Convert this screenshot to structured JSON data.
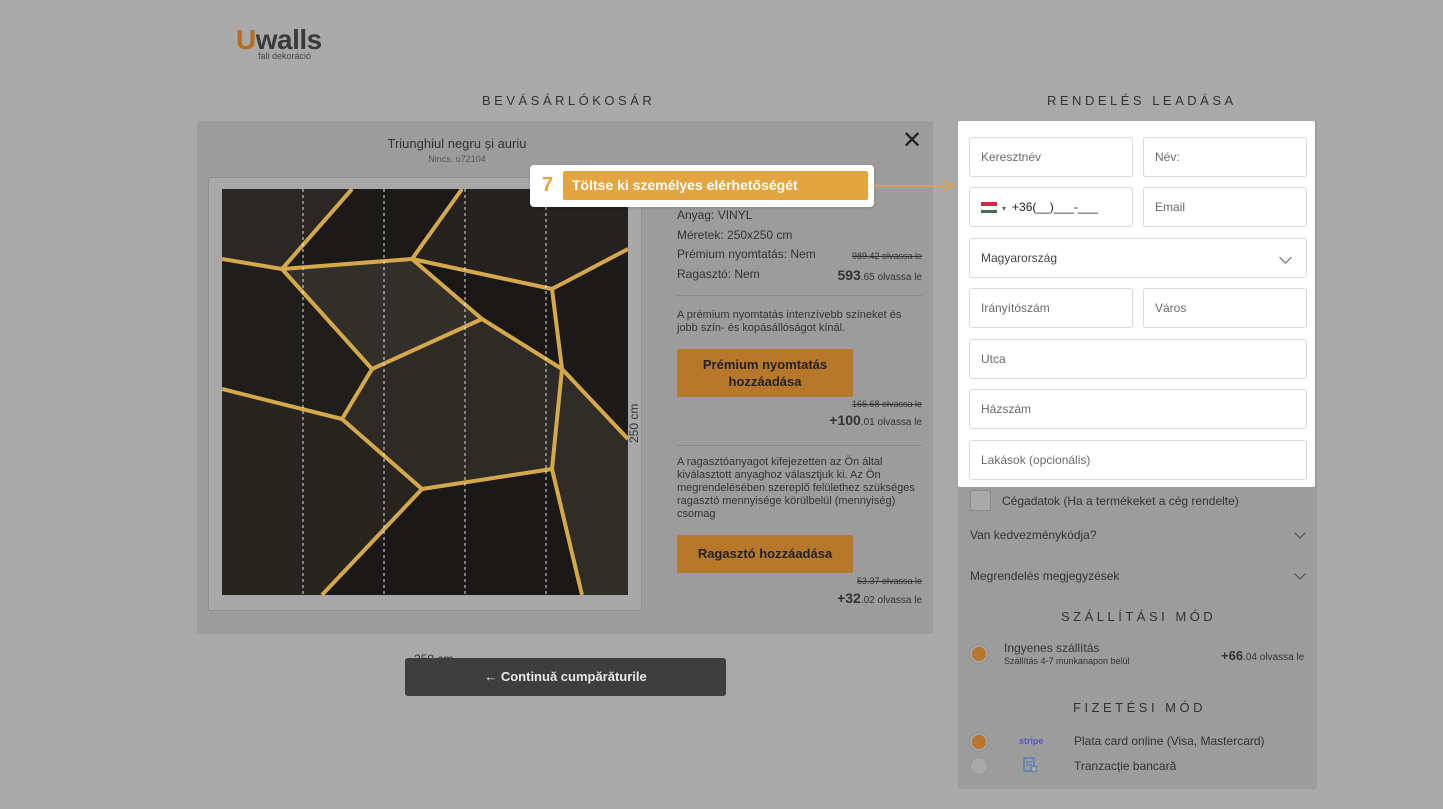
{
  "logo": {
    "brand_prefix": "U",
    "brand_rest": "walls",
    "tagline": "fali dekoráció"
  },
  "cart": {
    "title": "BEVÁSÁRLÓKOSÁR",
    "product_name": "Triunghiul negru și auriu",
    "product_code": "Nincs. u72104",
    "dim_width": "250  cm",
    "dim_height": "250  cm",
    "specs": {
      "material": "Anyag:  VINYL",
      "size": "Méretek:  250x250 cm",
      "premium": "Prémium nyomtatás:  Nem",
      "adhesive": "Ragasztó:  Nem"
    },
    "price_old": "989.42 olvassa le",
    "price_new_int": "593",
    "price_new_rest": ".65 olvassa le",
    "premium_note": "A prémium nyomtatás intenzívebb színeket és jobb szín- és kopásállóságot kínál.",
    "premium_button": "Prémium nyomtatás hozzáadása",
    "premium_price_old": "166.68 olvassa le",
    "premium_price_int": "+100",
    "premium_price_rest": ".01 olvassa le",
    "adhesive_note": "A ragasztóanyagot kifejezetten az Ön által kiválasztott anyaghoz választjuk ki. Az Ön megrendelésében szereplő felülethez szükséges ragasztó mennyisége körülbelül (mennyiség) csomag",
    "adhesive_button": "Ragasztó hozzáadása",
    "adhesive_price_old": "53.37 olvassa le",
    "adhesive_price_int": "+32",
    "adhesive_price_rest": ".02 olvassa le",
    "continue_button": "← Continuă cumpărăturile"
  },
  "order": {
    "title": "RENDELÉS LEADÁSA",
    "first_name_placeholder": "Keresztnév",
    "last_name_placeholder": "Név:",
    "phone_prefix": "▾",
    "phone_value": "+36(__)___-___",
    "email_placeholder": "Email",
    "country": "Magyarország",
    "zip_placeholder": "Irányítószám",
    "city_placeholder": "Város",
    "street_placeholder": "Utca",
    "house_placeholder": "Házszám",
    "apartment_placeholder": "Lakások (opcionális)",
    "company_checkbox": "Cégadatok (Ha a termékeket a cég rendelte)",
    "discount_label": "Van kedvezménykódja?",
    "comments_label": "Megrendelés megjegyzések",
    "shipping_title": "SZÁLLÍTÁSI MÓD",
    "shipping_option": "Ingyenes szállítás",
    "shipping_sub": "Szállítás 4-7 munkanapon belül",
    "shipping_price_int": "+66",
    "shipping_price_rest": ".04 olvassa le",
    "payment_title": "FIZETÉSI MÓD",
    "payment_stripe_logo": "stripe",
    "payment_card": "Plata card online (Visa, Mastercard)",
    "payment_bank": "Tranzacție bancară"
  },
  "tooltip": {
    "step": "7",
    "text": "Töltse ki személyes elérhetőségét"
  },
  "colors": {
    "accent": "#b8782c",
    "tooltip": "#e3a540",
    "overlay": "#a9a9a9",
    "flag_red": "#cd2a3e",
    "flag_white": "#ffffff",
    "flag_green": "#436f4d"
  }
}
